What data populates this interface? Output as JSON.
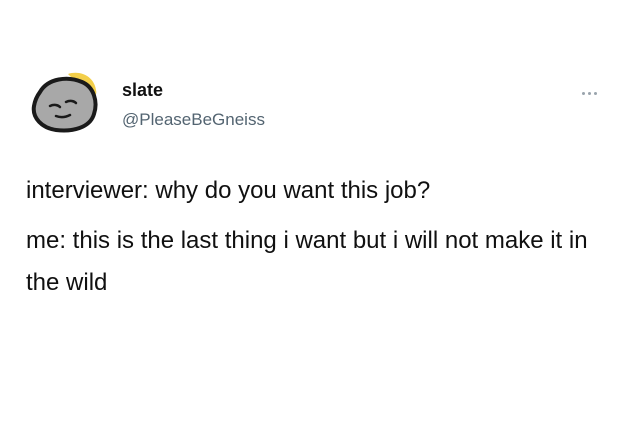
{
  "tweet": {
    "author": {
      "display_name": "slate",
      "handle": "@PleaseBeGneiss",
      "avatar_icon": "rock-avatar-icon"
    },
    "more_icon": "more-horizontal-icon",
    "text_lines": [
      "interviewer: why do you want this job?",
      "me: this is the last thing i want but i will not make it in the wild"
    ]
  }
}
